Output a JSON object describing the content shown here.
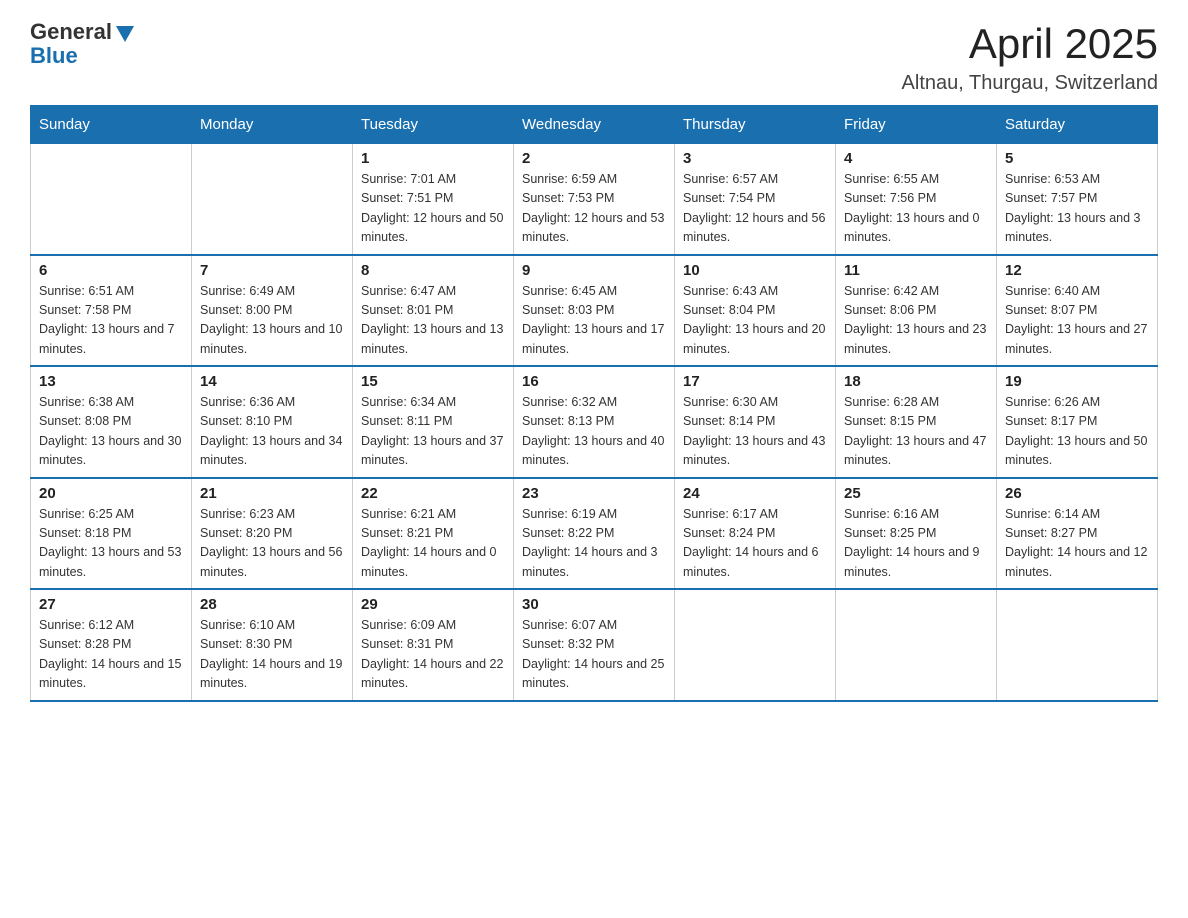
{
  "header": {
    "logo_general": "General",
    "logo_blue": "Blue",
    "month_year": "April 2025",
    "location": "Altnau, Thurgau, Switzerland"
  },
  "days_of_week": [
    "Sunday",
    "Monday",
    "Tuesday",
    "Wednesday",
    "Thursday",
    "Friday",
    "Saturday"
  ],
  "weeks": [
    [
      {
        "day": "",
        "sunrise": "",
        "sunset": "",
        "daylight": ""
      },
      {
        "day": "",
        "sunrise": "",
        "sunset": "",
        "daylight": ""
      },
      {
        "day": "1",
        "sunrise": "Sunrise: 7:01 AM",
        "sunset": "Sunset: 7:51 PM",
        "daylight": "Daylight: 12 hours and 50 minutes."
      },
      {
        "day": "2",
        "sunrise": "Sunrise: 6:59 AM",
        "sunset": "Sunset: 7:53 PM",
        "daylight": "Daylight: 12 hours and 53 minutes."
      },
      {
        "day": "3",
        "sunrise": "Sunrise: 6:57 AM",
        "sunset": "Sunset: 7:54 PM",
        "daylight": "Daylight: 12 hours and 56 minutes."
      },
      {
        "day": "4",
        "sunrise": "Sunrise: 6:55 AM",
        "sunset": "Sunset: 7:56 PM",
        "daylight": "Daylight: 13 hours and 0 minutes."
      },
      {
        "day": "5",
        "sunrise": "Sunrise: 6:53 AM",
        "sunset": "Sunset: 7:57 PM",
        "daylight": "Daylight: 13 hours and 3 minutes."
      }
    ],
    [
      {
        "day": "6",
        "sunrise": "Sunrise: 6:51 AM",
        "sunset": "Sunset: 7:58 PM",
        "daylight": "Daylight: 13 hours and 7 minutes."
      },
      {
        "day": "7",
        "sunrise": "Sunrise: 6:49 AM",
        "sunset": "Sunset: 8:00 PM",
        "daylight": "Daylight: 13 hours and 10 minutes."
      },
      {
        "day": "8",
        "sunrise": "Sunrise: 6:47 AM",
        "sunset": "Sunset: 8:01 PM",
        "daylight": "Daylight: 13 hours and 13 minutes."
      },
      {
        "day": "9",
        "sunrise": "Sunrise: 6:45 AM",
        "sunset": "Sunset: 8:03 PM",
        "daylight": "Daylight: 13 hours and 17 minutes."
      },
      {
        "day": "10",
        "sunrise": "Sunrise: 6:43 AM",
        "sunset": "Sunset: 8:04 PM",
        "daylight": "Daylight: 13 hours and 20 minutes."
      },
      {
        "day": "11",
        "sunrise": "Sunrise: 6:42 AM",
        "sunset": "Sunset: 8:06 PM",
        "daylight": "Daylight: 13 hours and 23 minutes."
      },
      {
        "day": "12",
        "sunrise": "Sunrise: 6:40 AM",
        "sunset": "Sunset: 8:07 PM",
        "daylight": "Daylight: 13 hours and 27 minutes."
      }
    ],
    [
      {
        "day": "13",
        "sunrise": "Sunrise: 6:38 AM",
        "sunset": "Sunset: 8:08 PM",
        "daylight": "Daylight: 13 hours and 30 minutes."
      },
      {
        "day": "14",
        "sunrise": "Sunrise: 6:36 AM",
        "sunset": "Sunset: 8:10 PM",
        "daylight": "Daylight: 13 hours and 34 minutes."
      },
      {
        "day": "15",
        "sunrise": "Sunrise: 6:34 AM",
        "sunset": "Sunset: 8:11 PM",
        "daylight": "Daylight: 13 hours and 37 minutes."
      },
      {
        "day": "16",
        "sunrise": "Sunrise: 6:32 AM",
        "sunset": "Sunset: 8:13 PM",
        "daylight": "Daylight: 13 hours and 40 minutes."
      },
      {
        "day": "17",
        "sunrise": "Sunrise: 6:30 AM",
        "sunset": "Sunset: 8:14 PM",
        "daylight": "Daylight: 13 hours and 43 minutes."
      },
      {
        "day": "18",
        "sunrise": "Sunrise: 6:28 AM",
        "sunset": "Sunset: 8:15 PM",
        "daylight": "Daylight: 13 hours and 47 minutes."
      },
      {
        "day": "19",
        "sunrise": "Sunrise: 6:26 AM",
        "sunset": "Sunset: 8:17 PM",
        "daylight": "Daylight: 13 hours and 50 minutes."
      }
    ],
    [
      {
        "day": "20",
        "sunrise": "Sunrise: 6:25 AM",
        "sunset": "Sunset: 8:18 PM",
        "daylight": "Daylight: 13 hours and 53 minutes."
      },
      {
        "day": "21",
        "sunrise": "Sunrise: 6:23 AM",
        "sunset": "Sunset: 8:20 PM",
        "daylight": "Daylight: 13 hours and 56 minutes."
      },
      {
        "day": "22",
        "sunrise": "Sunrise: 6:21 AM",
        "sunset": "Sunset: 8:21 PM",
        "daylight": "Daylight: 14 hours and 0 minutes."
      },
      {
        "day": "23",
        "sunrise": "Sunrise: 6:19 AM",
        "sunset": "Sunset: 8:22 PM",
        "daylight": "Daylight: 14 hours and 3 minutes."
      },
      {
        "day": "24",
        "sunrise": "Sunrise: 6:17 AM",
        "sunset": "Sunset: 8:24 PM",
        "daylight": "Daylight: 14 hours and 6 minutes."
      },
      {
        "day": "25",
        "sunrise": "Sunrise: 6:16 AM",
        "sunset": "Sunset: 8:25 PM",
        "daylight": "Daylight: 14 hours and 9 minutes."
      },
      {
        "day": "26",
        "sunrise": "Sunrise: 6:14 AM",
        "sunset": "Sunset: 8:27 PM",
        "daylight": "Daylight: 14 hours and 12 minutes."
      }
    ],
    [
      {
        "day": "27",
        "sunrise": "Sunrise: 6:12 AM",
        "sunset": "Sunset: 8:28 PM",
        "daylight": "Daylight: 14 hours and 15 minutes."
      },
      {
        "day": "28",
        "sunrise": "Sunrise: 6:10 AM",
        "sunset": "Sunset: 8:30 PM",
        "daylight": "Daylight: 14 hours and 19 minutes."
      },
      {
        "day": "29",
        "sunrise": "Sunrise: 6:09 AM",
        "sunset": "Sunset: 8:31 PM",
        "daylight": "Daylight: 14 hours and 22 minutes."
      },
      {
        "day": "30",
        "sunrise": "Sunrise: 6:07 AM",
        "sunset": "Sunset: 8:32 PM",
        "daylight": "Daylight: 14 hours and 25 minutes."
      },
      {
        "day": "",
        "sunrise": "",
        "sunset": "",
        "daylight": ""
      },
      {
        "day": "",
        "sunrise": "",
        "sunset": "",
        "daylight": ""
      },
      {
        "day": "",
        "sunrise": "",
        "sunset": "",
        "daylight": ""
      }
    ]
  ]
}
